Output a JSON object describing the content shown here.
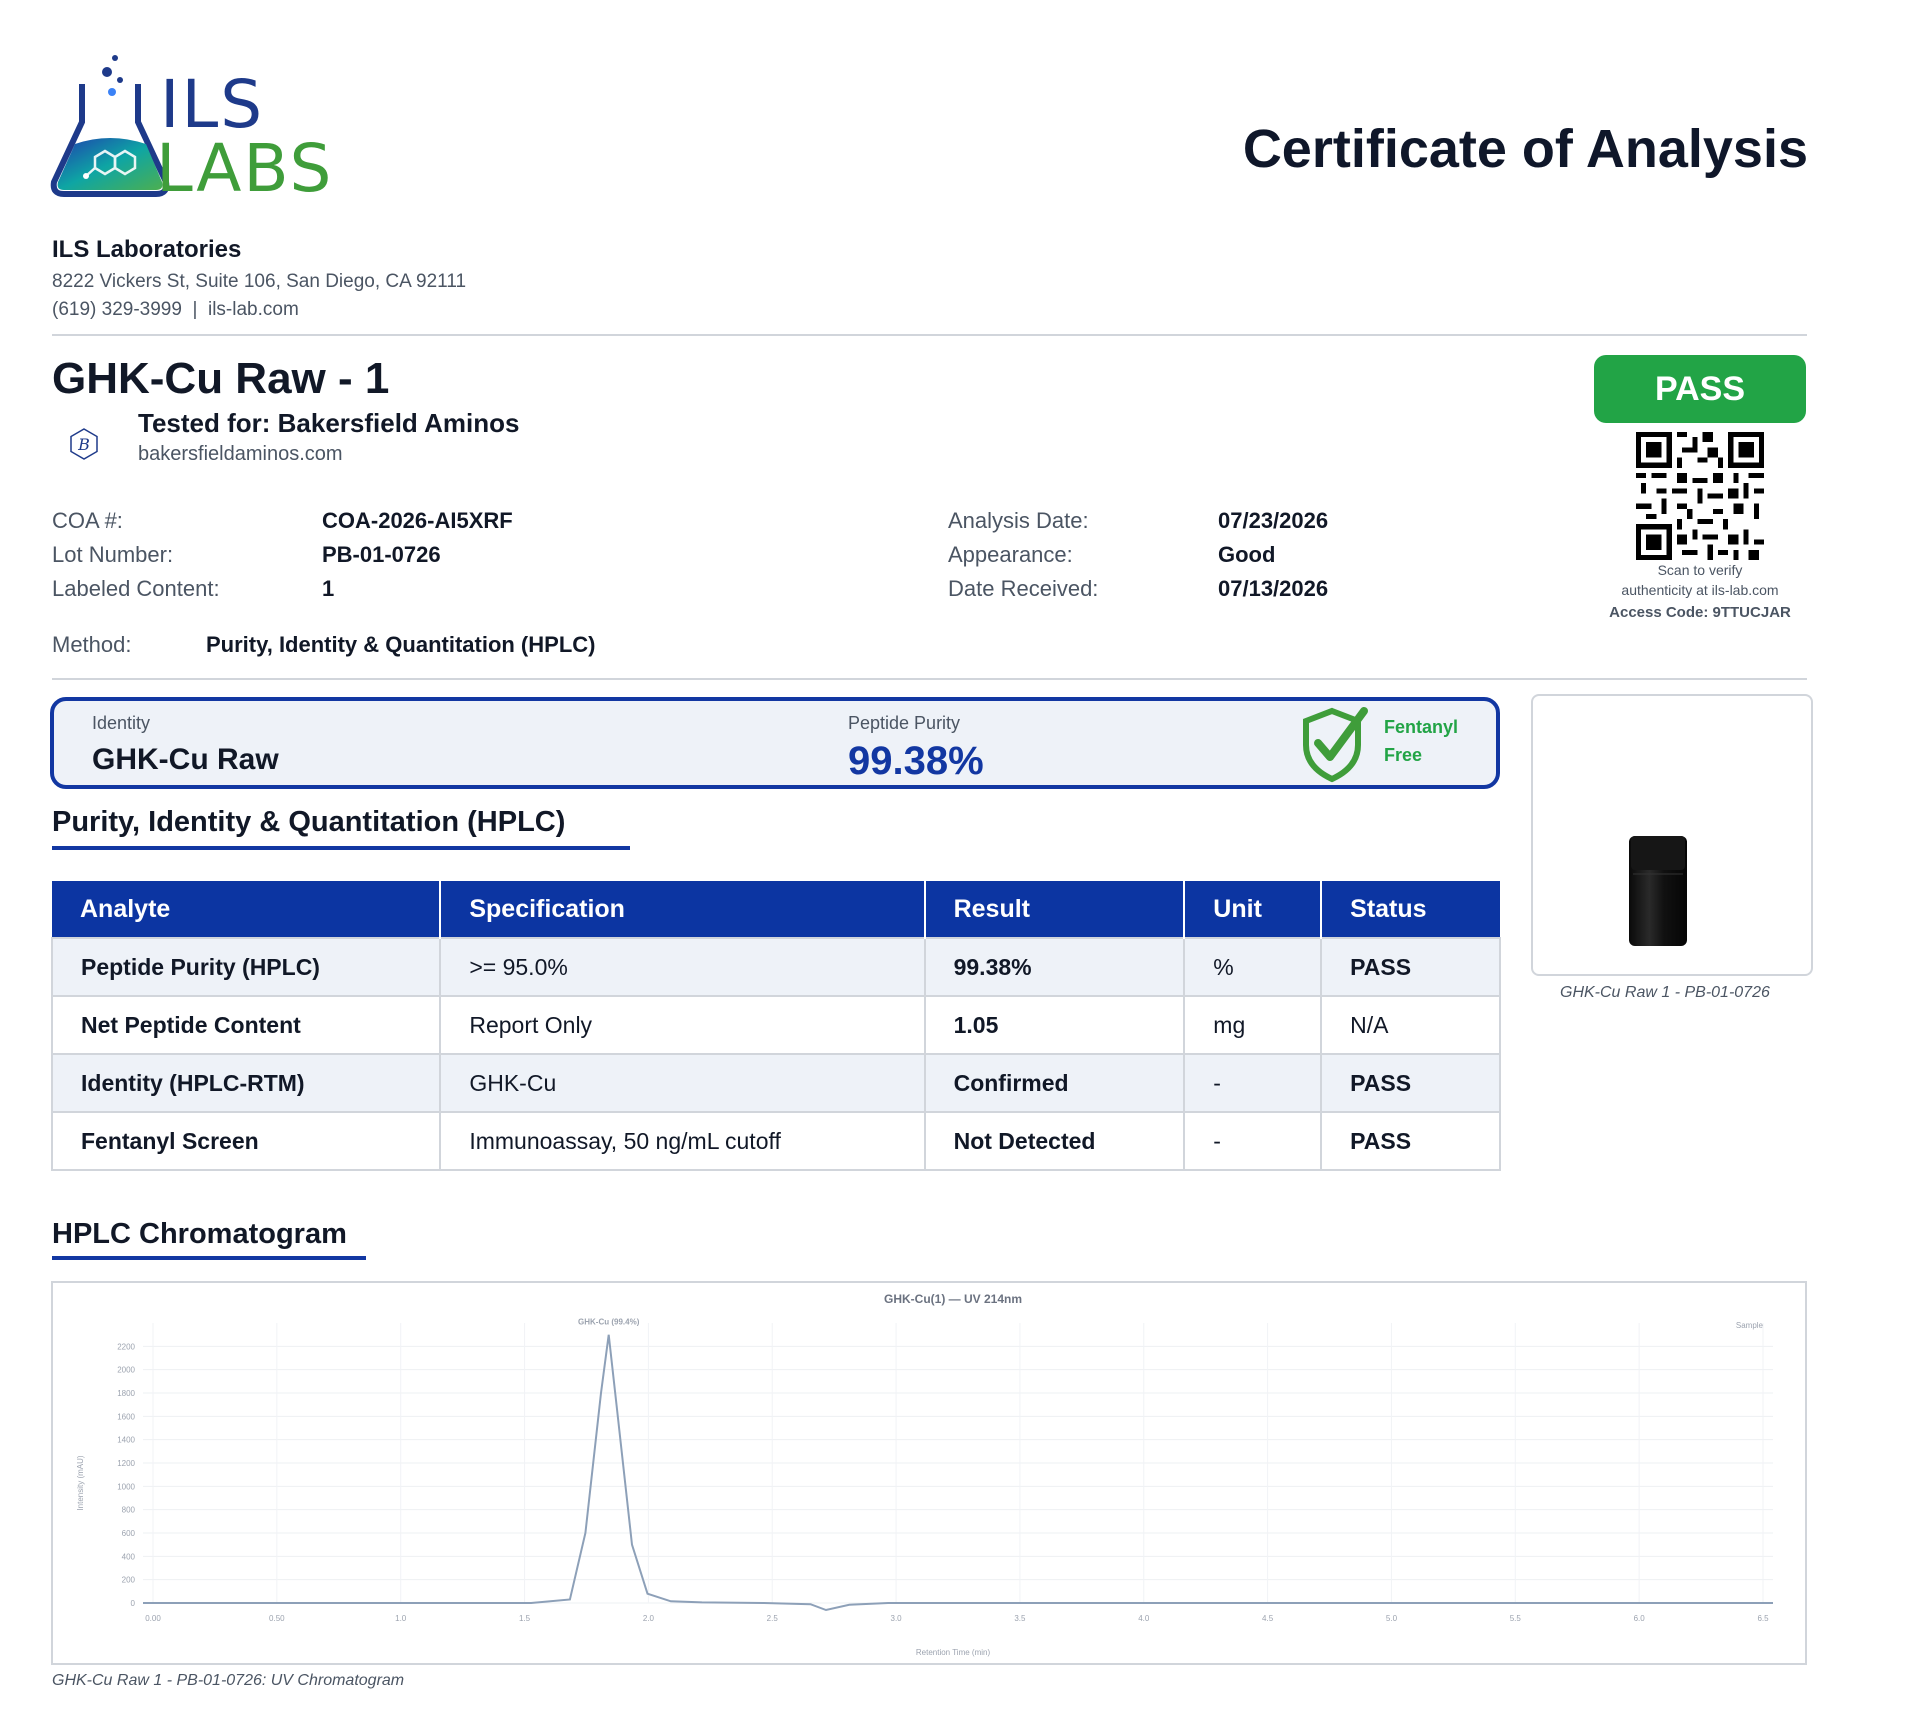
{
  "logo": {
    "line1": "ILS",
    "line2": "LABS"
  },
  "header": {
    "title": "Certificate of Analysis"
  },
  "lab": {
    "name": "ILS Laboratories",
    "address": "8222 Vickers St, Suite 106, San Diego, CA 92111",
    "contact": "(619) 329-3999  |  ils-lab.com"
  },
  "product": {
    "title": "GHK-Cu Raw - 1",
    "tested_for": "Tested for: Bakersfield Aminos",
    "client_site": "bakersfieldaminos.com",
    "overall_status": "PASS"
  },
  "meta": {
    "left": [
      {
        "label": "COA #:",
        "value": "COA-2026-AI5XRF"
      },
      {
        "label": "Lot Number:",
        "value": "PB-01-0726"
      },
      {
        "label": "Labeled Content:",
        "value": "1"
      }
    ],
    "right": [
      {
        "label": "Analysis Date:",
        "value": "07/23/2026"
      },
      {
        "label": "Appearance:",
        "value": "Good"
      },
      {
        "label": "Date Received:",
        "value": "07/13/2026"
      }
    ],
    "method_label": "Method:",
    "method_value": "Purity, Identity & Quantitation (HPLC)"
  },
  "qr": {
    "caption_line1": "Scan to verify",
    "caption_line2": "authenticity at ils-lab.com",
    "access_code": "Access Code: 9TTUCJAR"
  },
  "summary": {
    "identity_label": "Identity",
    "identity_value": "GHK-Cu Raw",
    "purity_label": "Peptide Purity",
    "purity_value": "99.38%",
    "fentanyl_line1": "Fentanyl",
    "fentanyl_line2": "Free"
  },
  "results_section": {
    "title": "Purity, Identity & Quantitation (HPLC)",
    "columns": [
      "Analyte",
      "Specification",
      "Result",
      "Unit",
      "Status"
    ],
    "rows": [
      {
        "analyte": "Peptide Purity (HPLC)",
        "spec": ">= 95.0%",
        "result": "99.38%",
        "unit": "%",
        "status": "PASS"
      },
      {
        "analyte": "Net Peptide Content",
        "spec": "Report Only",
        "result": "1.05",
        "unit": "mg",
        "status": "N/A"
      },
      {
        "analyte": "Identity (HPLC-RTM)",
        "spec": "GHK-Cu",
        "result": "Confirmed",
        "unit": "-",
        "status": "PASS"
      },
      {
        "analyte": "Fentanyl Screen",
        "spec": "Immunoassay, 50 ng/mL cutoff",
        "result": "Not Detected",
        "unit": "-",
        "status": "PASS"
      }
    ]
  },
  "photo": {
    "caption": "GHK-Cu Raw 1 - PB-01-0726"
  },
  "chromatogram": {
    "section_title": "HPLC Chromatogram",
    "caption": "GHK-Cu Raw 1 - PB-01-0726: UV Chromatogram"
  },
  "colors": {
    "brand_blue": "#1237a2",
    "pass_green": "#22a446",
    "table_header": "#0c35a2"
  },
  "chart_data": {
    "type": "line",
    "title": "GHK-Cu(1) — UV 214nm",
    "xlabel": "Retention Time (min)",
    "ylabel": "Intensity (mAU)",
    "peak_label": "GHK-Cu (99.4%)",
    "legend": "Sample",
    "legend_position": "top-right",
    "grid": true,
    "xlim": [
      0,
      10.5
    ],
    "ylim": [
      0,
      2400
    ],
    "x_ticks": [
      "0.00",
      "0.50",
      "1.0",
      "1.5",
      "2.0",
      "2.5",
      "3.0",
      "3.5",
      "4.0",
      "4.5",
      "5.0",
      "5.5",
      "6.0",
      "6.5"
    ],
    "y_ticks": [
      "0",
      "200",
      "400",
      "600",
      "800",
      "1000",
      "1200",
      "1400",
      "1600",
      "1800",
      "2000",
      "2200"
    ],
    "series": [
      {
        "name": "Sample",
        "x": [
          0.0,
          2.5,
          2.75,
          2.85,
          2.95,
          3.0,
          3.05,
          3.15,
          3.25,
          3.4,
          3.6,
          4.0,
          4.3,
          4.4,
          4.55,
          4.8,
          6.0,
          8.0,
          9.5,
          10.0,
          10.5
        ],
        "y": [
          0,
          0,
          30,
          600,
          1800,
          2300,
          1700,
          500,
          80,
          15,
          5,
          0,
          -10,
          -60,
          -15,
          0,
          0,
          0,
          0,
          0,
          0
        ]
      }
    ]
  }
}
